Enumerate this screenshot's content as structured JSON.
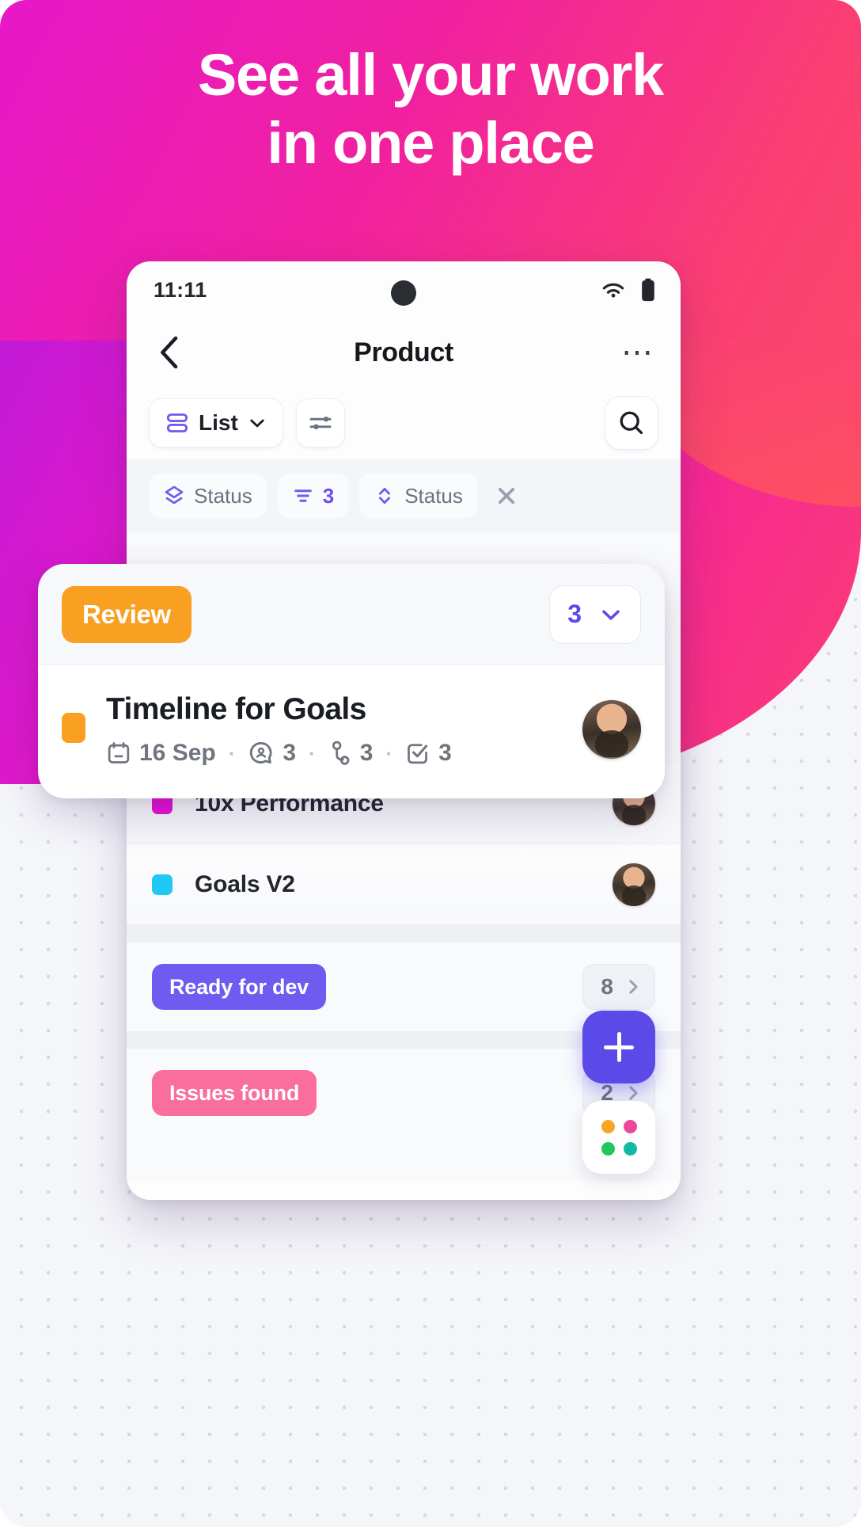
{
  "promo": {
    "headline_line1": "See all your work",
    "headline_line2": "in one place",
    "gradient_start": "#e718c8",
    "gradient_end": "#fd4f63"
  },
  "phone": {
    "status_bar": {
      "time": "11:11",
      "wifi_icon": "wifi-icon",
      "battery_icon": "battery-icon",
      "camera_icon": "camera-punch-hole"
    },
    "nav": {
      "back_icon": "chevron-left-icon",
      "title": "Product",
      "more_icon": "more-horizontal-icon"
    },
    "toolbar": {
      "view_label": "List",
      "view_icon": "list-view-icon",
      "view_chevron": "chevron-down-icon",
      "settings_icon": "sliders-icon",
      "search_icon": "search-icon"
    },
    "filter_chips": [
      {
        "label": "Status",
        "icon": "layers-icon",
        "is_number": false
      },
      {
        "label": "3",
        "icon": "filter-icon",
        "is_number": true
      },
      {
        "label": "Status",
        "icon": "sort-icon",
        "is_number": false
      }
    ],
    "clear_filters_icon": "close-icon",
    "task_rows": [
      {
        "name": "10x Performance",
        "color": "#e711d8",
        "avatar": "user-avatar"
      },
      {
        "name": "Goals V2",
        "color": "#1fc8f5",
        "avatar": "user-avatar"
      }
    ],
    "status_groups": [
      {
        "label": "Ready for dev",
        "color": "#6f5bf0",
        "count": "8",
        "chevron": "chevron-right-icon"
      },
      {
        "label": "Issues found",
        "color": "#fa6e9e",
        "count": "2",
        "chevron": "chevron-right-icon"
      }
    ],
    "fab": {
      "icon": "plus-icon",
      "color": "#5b4ae8"
    },
    "app_switcher": {
      "icon": "app-grid-icon",
      "dot_colors": [
        "#f5a623",
        "#ec4899",
        "#22c55e",
        "#14b8a6"
      ]
    }
  },
  "review_card": {
    "badge_label": "Review",
    "badge_color": "#f9a023",
    "count": "3",
    "count_chevron": "chevron-down-icon",
    "task": {
      "title": "Timeline for Goals",
      "marker_color": "#f9a023",
      "date": "16 Sep",
      "date_icon": "calendar-icon",
      "comments": "3",
      "comments_icon": "comment-icon",
      "subtasks": "3",
      "subtasks_icon": "subtask-icon",
      "checklist": "3",
      "checklist_icon": "checklist-icon",
      "separator": "·",
      "avatar": "user-avatar"
    }
  }
}
